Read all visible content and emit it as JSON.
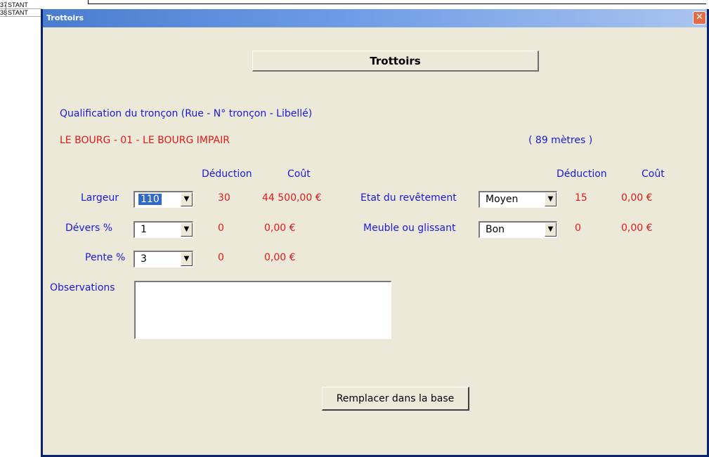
{
  "background": {
    "rows": [
      {
        "num": "37",
        "text": "STANT"
      },
      {
        "num": "38",
        "text": "STANT"
      }
    ]
  },
  "window": {
    "title": "Trottoirs",
    "close_glyph": "✕"
  },
  "header": {
    "label": "Trottoirs"
  },
  "section": {
    "qualification_label": "Qualification du tronçon (Rue - N° tronçon - Libellé)",
    "troncon_value": "LE BOURG - 01 - LE BOURG IMPAIR",
    "length_text": "( 89 mètres )"
  },
  "left_columns": {
    "deduction": "Déduction",
    "cout": "Coût"
  },
  "right_columns": {
    "deduction": "Déduction",
    "cout": "Coût"
  },
  "largeur": {
    "label": "Largeur",
    "value": "110",
    "deduction": "30",
    "cout": "44 500,00 €"
  },
  "devers": {
    "label": "Dévers %",
    "value": "1",
    "deduction": "0",
    "cout": "0,00 €"
  },
  "pente": {
    "label": "Pente %",
    "value": "3",
    "deduction": "0",
    "cout": "0,00 €"
  },
  "etat": {
    "label": "Etat du revêtement",
    "value": "Moyen",
    "deduction": "15",
    "cout": "0,00 €"
  },
  "meuble": {
    "label": "Meuble ou glissant",
    "value": "Bon",
    "deduction": "0",
    "cout": "0,00 €"
  },
  "observations": {
    "label": "Observations",
    "value": ""
  },
  "actions": {
    "replace_label": "Remplacer dans la base"
  },
  "colors": {
    "label_blue": "#1a1ad8",
    "value_red": "#e01a1a",
    "dialog_bg": "#ece9d8",
    "titlebar": "#6d9be6"
  }
}
